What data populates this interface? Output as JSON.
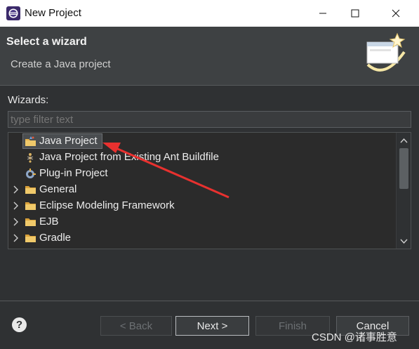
{
  "window": {
    "title": "New Project",
    "icon": "eclipse-icon"
  },
  "header": {
    "title": "Select a wizard",
    "description": "Create a Java project"
  },
  "wizards": {
    "label": "Wizards:",
    "filter_placeholder": "type filter text",
    "items": [
      {
        "label": "Java Project",
        "icon": "java-project-icon",
        "expandable": false,
        "selected": true
      },
      {
        "label": "Java Project from Existing Ant Buildfile",
        "icon": "ant-buildfile-icon",
        "expandable": false,
        "selected": false
      },
      {
        "label": "Plug-in Project",
        "icon": "plugin-project-icon",
        "expandable": false,
        "selected": false
      },
      {
        "label": "General",
        "icon": "folder-icon",
        "expandable": true,
        "selected": false
      },
      {
        "label": "Eclipse Modeling Framework",
        "icon": "folder-icon",
        "expandable": true,
        "selected": false
      },
      {
        "label": "EJB",
        "icon": "folder-icon",
        "expandable": true,
        "selected": false
      },
      {
        "label": "Gradle",
        "icon": "folder-icon",
        "expandable": true,
        "selected": false
      }
    ]
  },
  "buttons": {
    "help": "?",
    "back": "< Back",
    "next": "Next >",
    "finish": "Finish",
    "cancel": "Cancel"
  },
  "watermark": "CSDN @诸事胜意",
  "colors": {
    "annotation_arrow": "#e8312f",
    "folder": "#e7b24a",
    "selection": "#4a4d50"
  }
}
